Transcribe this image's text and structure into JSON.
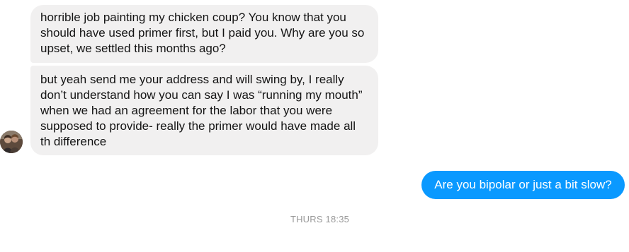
{
  "thread": {
    "incoming": [
      {
        "text": "horrible job painting my chicken coup? You know that you should have used primer first, but I paid you. Why are you so upset, we settled this months ago?"
      },
      {
        "text": "but yeah send me your address and will swing by, I really don’t understand how you can say I was “running my mouth” when we had an agreement for the labor that you were supposed to provide- really the primer would have made all th difference"
      }
    ],
    "outgoing": [
      {
        "text": "Are you bipolar or just a bit slow?"
      }
    ],
    "timestamp": "THURS 18:35"
  },
  "colors": {
    "incoming_bubble": "#f1f0f0",
    "outgoing_bubble": "#0a99ff",
    "timestamp_text": "#999999"
  },
  "icons": {
    "avatar": "contact-avatar-photo"
  }
}
